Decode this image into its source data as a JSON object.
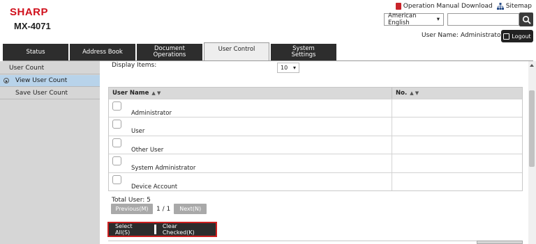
{
  "header": {
    "brand": "SHARP",
    "model": "MX-4071",
    "manual_link": "Operation Manual Download",
    "sitemap_link": "Sitemap",
    "language": "American English",
    "search_placeholder": "",
    "user_name_label": "User Name: Administrator",
    "logout_label": "Logout"
  },
  "tabs": [
    {
      "label": "Status"
    },
    {
      "label": "Address Book"
    },
    {
      "label": "Document Operations"
    },
    {
      "label": "User Control"
    },
    {
      "label": "System Settings"
    }
  ],
  "sidebar": {
    "items": [
      {
        "label": "User Count"
      },
      {
        "label": "View User Count"
      },
      {
        "label": "Save User Count"
      }
    ]
  },
  "main": {
    "display_items_label": "Display Items:",
    "display_items_value": "10",
    "table": {
      "columns": [
        "User Name",
        "No."
      ],
      "sort_icons": "▲ ▼",
      "rows": [
        {
          "name": "Administrator",
          "no": ""
        },
        {
          "name": "User",
          "no": ""
        },
        {
          "name": "Other User",
          "no": ""
        },
        {
          "name": "System Administrator",
          "no": ""
        },
        {
          "name": "Device Account",
          "no": ""
        }
      ]
    },
    "total_user": "Total User:  5",
    "pager": {
      "prev": "Previous(M)",
      "info": "1 / 1",
      "next": "Next(N)"
    },
    "actions": {
      "select_all": "Select All(S)",
      "clear_checked": "Clear Checked(K)"
    }
  },
  "colors": {
    "brand": "#d0101c",
    "tab_dark": "#2d2d2d",
    "sidebar_active": "#b8d3ea",
    "highlight_border": "#cc1f1f"
  }
}
